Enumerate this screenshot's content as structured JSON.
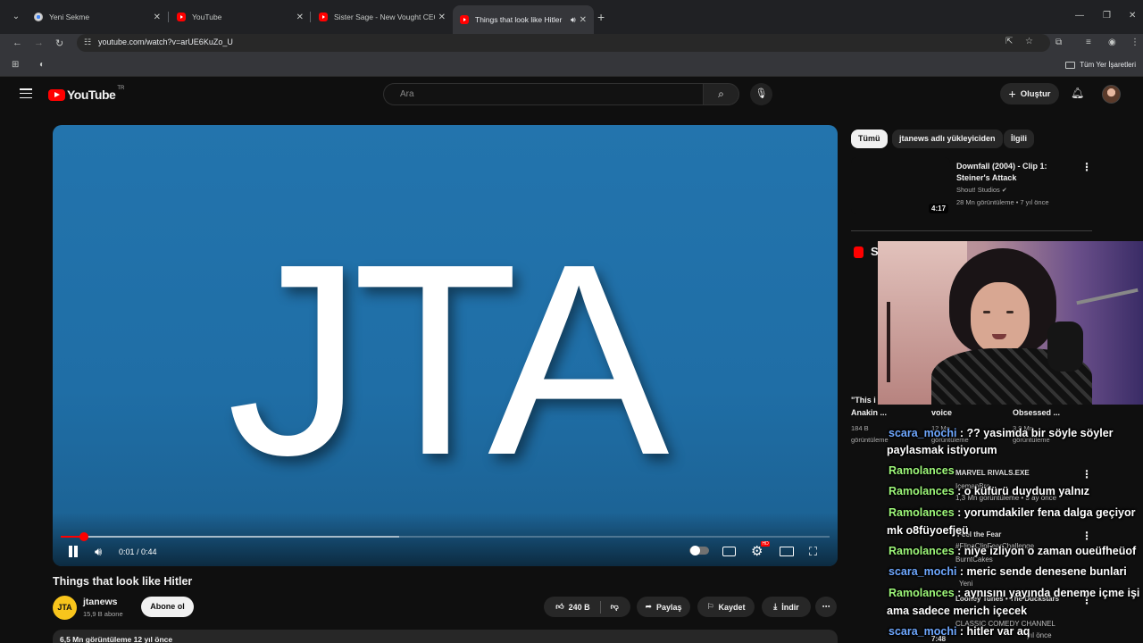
{
  "browser": {
    "tabs": [
      {
        "label": "Yeni Sekme",
        "favicon": "chrome-icon"
      },
      {
        "label": "YouTube",
        "favicon": "youtube-icon"
      },
      {
        "label": "Sister Sage - New Vought CEO",
        "favicon": "youtube-icon"
      },
      {
        "label": "Things that look like Hitler",
        "favicon": "youtube-icon",
        "active": true,
        "audio": true
      }
    ],
    "url": "youtube.com/watch?v=arUE6KuZo_U",
    "bookmarks_all": "Tüm Yer İşaretleri"
  },
  "youtube": {
    "logo_text": "YouTube",
    "country": "TR",
    "search_placeholder": "Ara",
    "create_label": "Oluştur"
  },
  "player": {
    "logo_text": "JTA",
    "time": "0:01 / 0:44",
    "progress_played": 0.03,
    "progress_buffered": 0.44,
    "background_color": "#2374ad"
  },
  "video": {
    "title": "Things that look like Hitler",
    "channel": "jtanews",
    "channel_avatar": "JTA",
    "subscribers": "15,9 B abone",
    "subscribe_label": "Abone ol",
    "likes": "240 B",
    "share_label": "Paylaş",
    "save_label": "Kaydet",
    "download_label": "İndir",
    "stats": "6,5 Mn görüntüleme  12 yıl önce"
  },
  "sidebar": {
    "chips": [
      "Tümü",
      "jtanews adlı yükleyiciden",
      "İlgili"
    ],
    "rec": {
      "title": "Downfall (2004) - Clip 1: Steiner's Attack",
      "channel": "Shout! Studios",
      "meta": "28 Mn görüntüleme • 7 yıl önce",
      "duration": "4:17"
    },
    "shorts_letter": "S",
    "shorts": [
      {
        "title": "\"This i",
        "title2": "Anakin ...",
        "views": "184 B",
        "views2": "görüntüleme"
      },
      {
        "title": "voice",
        "views": "12 Mn",
        "views2": "görüntüleme"
      },
      {
        "title": "Obsessed ...",
        "views": "3,9 Mn",
        "views2": "görüntüleme"
      }
    ],
    "ghosts": [
      "MARVEL RIVALS.EXE",
      "IcemanBro",
      "1,3 Mn görüntüleme • 3 ay önce",
      "Feel the Fear",
      "#FlipaClipFearChallenge",
      "BurntCakes",
      "Yeni",
      "Looney Tunes • The Duckstars",
      "CLASSIC COMEDY CHANNEL",
      "yıl önce",
      "7:48"
    ]
  },
  "chat": [
    {
      "user": "scara_mochi",
      "text": " : ?? yasimda bir söyle söyler",
      "blue": true
    },
    {
      "user": "",
      "text": "paylasmak istiyorum"
    },
    {
      "user": "Ramolances",
      "text": ""
    },
    {
      "user": "Ramolances",
      "text": " : o küfürü duydum yalnız"
    },
    {
      "user": "Ramolances",
      "text": " : yorumdakiler fena dalga geçiyor"
    },
    {
      "user": "",
      "text": "mk o8füyoefjeü"
    },
    {
      "user": "Ramolances",
      "text": " : niye izliyon o zaman oueüfheüof"
    },
    {
      "user": "scara_mochi",
      "text": " : meric sende denesene bunlari",
      "blue": true
    },
    {
      "user": "Ramolances",
      "text": " : aynısını yayında deneme içme işi"
    },
    {
      "user": "",
      "text": "ama sadece merich içecek"
    },
    {
      "user": "scara_mochi",
      "text": " : hitler var aq",
      "blue": true
    }
  ]
}
